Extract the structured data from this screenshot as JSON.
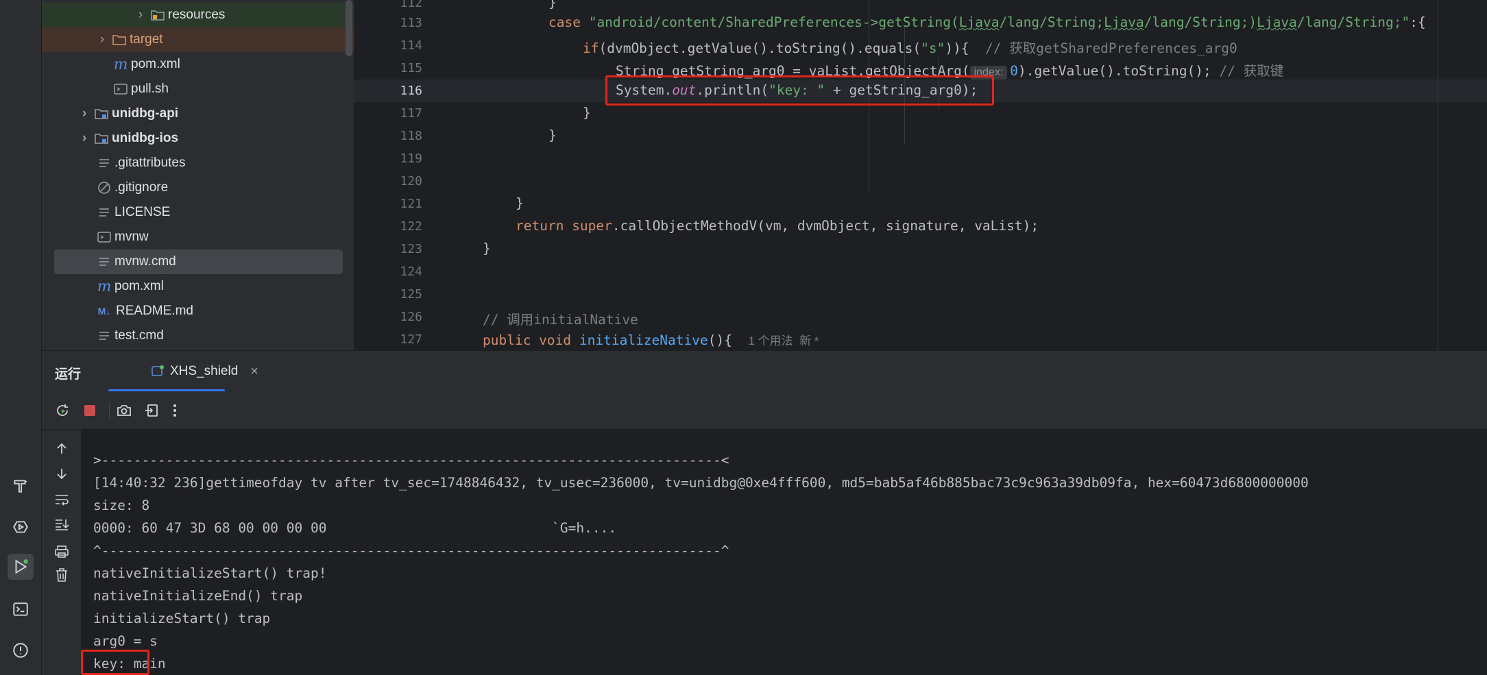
{
  "tree": {
    "items": [
      {
        "label": "resources",
        "bold": false
      },
      {
        "label": "target",
        "bold": false
      },
      {
        "label": "pom.xml",
        "bold": false
      },
      {
        "label": "pull.sh",
        "bold": false
      },
      {
        "label": "unidbg-api",
        "bold": true
      },
      {
        "label": "unidbg-ios",
        "bold": true
      },
      {
        "label": ".gitattributes",
        "bold": false
      },
      {
        "label": ".gitignore",
        "bold": false
      },
      {
        "label": "LICENSE",
        "bold": false
      },
      {
        "label": "mvnw",
        "bold": false
      },
      {
        "label": "mvnw.cmd",
        "bold": false
      },
      {
        "label": "pom.xml",
        "bold": false
      },
      {
        "label": "README.md",
        "bold": false
      },
      {
        "label": "test.cmd",
        "bold": false
      }
    ]
  },
  "editor": {
    "line_numbers": [
      "112",
      "113",
      "114",
      "115",
      "116",
      "117",
      "118",
      "119",
      "120",
      "121",
      "122",
      "123",
      "124",
      "125",
      "126",
      "127"
    ],
    "current_line": "116",
    "l112": "}",
    "l113_kw": "case ",
    "l113_str1": "\"android/content/SharedPreferences->getString(",
    "l113_u1": "Ljava",
    "l113_str2": "/lang/String;",
    "l113_u2": "Ljava",
    "l113_str3": "/lang/String;)",
    "l113_u3": "Ljava",
    "l113_str4": "/lang/String;\"",
    "l113_end": ":{",
    "l114_kw": "if",
    "l114_a": "(dvmObject.getValue().toString().equals(",
    "l114_str": "\"s\"",
    "l114_b": ")){",
    "l114_cm": "// 获取getSharedPreferences_arg0",
    "l115_a": "String getString_arg0 = vaList.getObjectArg(",
    "l115_hint": "index:",
    "l115_num": "0",
    "l115_b": ").getValue().toString();",
    "l115_cm": "// 获取键",
    "l116_a": "System.",
    "l116_out": "out",
    "l116_b": ".println(",
    "l116_str": "\"key: \"",
    "l116_c": " + getString_arg0);",
    "l117": "}",
    "l118": "}",
    "l121": "}",
    "l122_kw": "return ",
    "l122_kw2": "super",
    "l122_a": ".callObjectMethodV(vm, dvmObject, signature, vaList);",
    "l123": "}",
    "l126_cm": "// 调用initialNative",
    "l127_kw": "public void ",
    "l127_fn": "initializeNative",
    "l127_a": "(){",
    "l127_hint": "1 个用法  新 *"
  },
  "run": {
    "label": "运行",
    "tab": "XHS_shield"
  },
  "console": {
    "lines": [
      ">-----------------------------------------------------------------------------<",
      "[14:40:32 236]gettimeofday tv after tv_sec=1748846432, tv_usec=236000, tv=unidbg@0xe4fff600, md5=bab5af46b885bac73c9c963a39db09fa, hex=60473d6800000000",
      "size: 8",
      "0000: 60 47 3D 68 00 00 00 00                            `G=h....",
      "^-----------------------------------------------------------------------------^",
      "nativeInitializeStart() trap!",
      "nativeInitializeEnd() trap",
      "initializeStart() trap",
      "arg0 = s",
      "key: main"
    ]
  },
  "colors": {
    "highlight_box": "#e0261c",
    "accent": "#3574f0"
  }
}
